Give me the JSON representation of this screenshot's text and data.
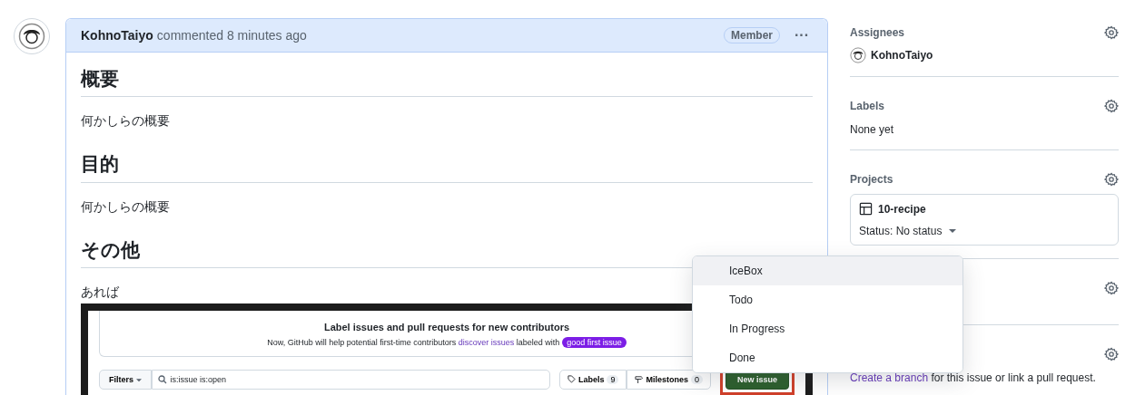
{
  "comment": {
    "author": "KohnoTaiyo",
    "meta": "commented 8 minutes ago",
    "badge": "Member",
    "menu": "···",
    "body": [
      {
        "kind": "heading",
        "text": "概要"
      },
      {
        "kind": "paragraph",
        "text": "何かしらの概要"
      },
      {
        "kind": "heading",
        "text": "目的"
      },
      {
        "kind": "paragraph",
        "text": "何かしらの概要"
      },
      {
        "kind": "heading",
        "text": "その他"
      },
      {
        "kind": "paragraph",
        "text": "あれば"
      },
      {
        "kind": "screenshot",
        "banner": {
          "title": "Label issues and pull requests for new contributors",
          "text_before": "Now, GitHub will help potential first-time contributors",
          "link": "discover issues",
          "text_after": "labeled with",
          "tag": "good first issue"
        },
        "toolbar": {
          "filters": "Filters",
          "search": "is:issue is:open",
          "labels": "Labels",
          "labels_count": "9",
          "milestones": "Milestones",
          "milestones_count": "0",
          "new_issue": "New issue"
        }
      }
    ]
  },
  "sidebar": [
    {
      "kind": "assignees",
      "title": "Assignees",
      "user": "KohnoTaiyo"
    },
    {
      "kind": "text",
      "title": "Labels",
      "text": "None yet"
    },
    {
      "kind": "project",
      "title": "Projects",
      "project": "10-recipe",
      "status": "Status: No status"
    },
    {
      "kind": "blank"
    },
    {
      "kind": "development",
      "link": "Create a branch",
      "text": "for this issue or link a pull request."
    }
  ],
  "dropdown": [
    {
      "label": "IceBox",
      "selected": true
    },
    {
      "label": "Todo",
      "selected": false
    },
    {
      "label": "In Progress",
      "selected": false
    },
    {
      "label": "Done",
      "selected": false
    }
  ]
}
